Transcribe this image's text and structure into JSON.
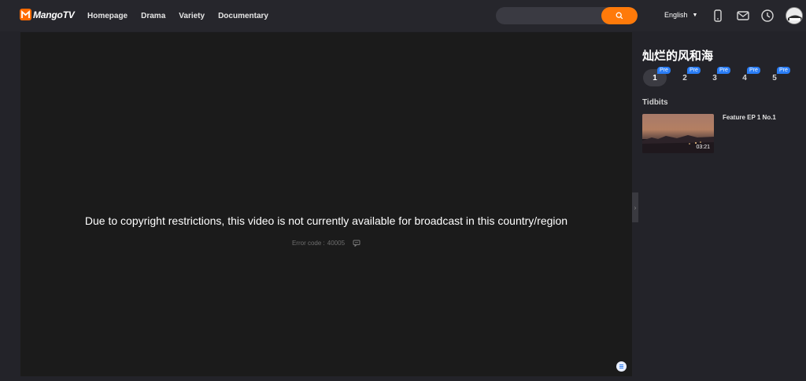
{
  "header": {
    "logo_text": "MangoTV",
    "nav": [
      "Homepage",
      "Drama",
      "Variety",
      "Documentary"
    ],
    "search": {
      "value": "",
      "placeholder": ""
    },
    "language": "English",
    "icons": [
      "mobile-icon",
      "mail-icon",
      "history-icon",
      "avatar"
    ]
  },
  "player": {
    "message": "Due to copyright restrictions, this video is not currently available for broadcast in this country/region",
    "error_label": "Error code :",
    "error_code": "40005"
  },
  "sidebar": {
    "title": "灿烂的风和海",
    "episodes": [
      {
        "num": "1",
        "badge": "Pre",
        "active": true
      },
      {
        "num": "2",
        "badge": "Pre",
        "active": false
      },
      {
        "num": "3",
        "badge": "Pre",
        "active": false
      },
      {
        "num": "4",
        "badge": "Pre",
        "active": false
      },
      {
        "num": "5",
        "badge": "Pre",
        "active": false
      }
    ],
    "tidbits_heading": "Tidbits",
    "tidbit": {
      "title": "Feature EP 1 No.1",
      "duration": "03:21"
    }
  },
  "colors": {
    "accent": "#ff7a0a",
    "badge": "#2a7df5",
    "background": "#232329",
    "player": "#1b1b1b"
  }
}
